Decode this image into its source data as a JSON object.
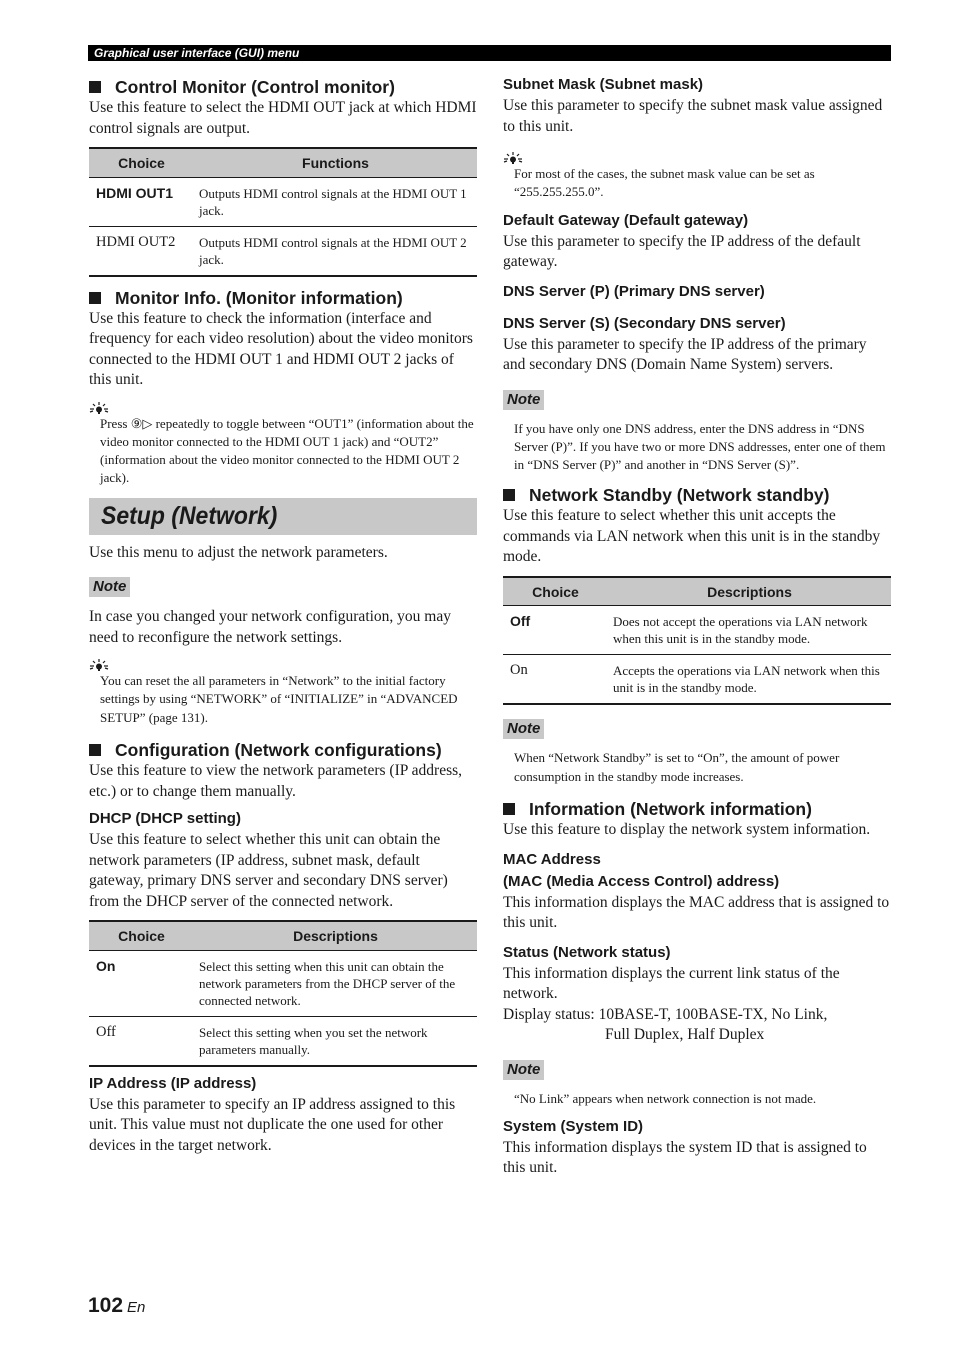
{
  "header": {
    "running_title": "Graphical user interface (GUI) menu"
  },
  "left": {
    "control_monitor": {
      "heading": "Control Monitor (Control monitor)",
      "body": "Use this feature to select the HDMI OUT jack at which HDMI control signals are output.",
      "table": {
        "headers": [
          "Choice",
          "Functions"
        ],
        "rows": [
          {
            "choice": "HDMI OUT1",
            "desc": "Outputs HDMI control signals at the HDMI OUT 1 jack."
          },
          {
            "choice": "HDMI OUT2",
            "desc": "Outputs HDMI control signals at the HDMI OUT 2 jack."
          }
        ]
      }
    },
    "monitor_info": {
      "heading": "Monitor Info. (Monitor information)",
      "body": "Use this feature to check the information (interface and frequency for each video resolution) about the video monitors connected to the HDMI OUT 1 and HDMI OUT 2 jacks of this unit.",
      "tip": "Press ⑨▷ repeatedly to toggle between “OUT1” (information about the video monitor connected to the HDMI OUT 1 jack) and “OUT2” (information about the video monitor connected to the HDMI OUT 2 jack)."
    },
    "setup_network": {
      "title": "Setup (Network)",
      "intro": "Use this menu to adjust the network parameters.",
      "note_label": "Note",
      "note": "In case you changed your network configuration, you may need to reconfigure the network settings.",
      "tip": "You can reset the all parameters in “Network” to the initial factory settings by using “NETWORK” of “INITIALIZE” in “ADVANCED SETUP” (page 131)."
    },
    "configuration": {
      "heading": "Configuration (Network configurations)",
      "body": "Use this feature to view the network parameters (IP address, etc.) or to change them manually.",
      "dhcp_heading": "DHCP (DHCP setting)",
      "dhcp_body": "Use this feature to select whether this unit can obtain the network parameters (IP address, subnet mask, default gateway, primary DNS server and secondary DNS server) from the DHCP server of the connected network.",
      "table": {
        "headers": [
          "Choice",
          "Descriptions"
        ],
        "rows": [
          {
            "choice": "On",
            "desc": "Select this setting when this unit can obtain the network parameters from the DHCP server of the connected network."
          },
          {
            "choice": "Off",
            "desc": "Select this setting when you set the network parameters manually."
          }
        ]
      },
      "ip_heading": "IP Address (IP address)",
      "ip_body": "Use this parameter to specify an IP address assigned to this unit. This value must not duplicate the one used for other devices in the target network."
    }
  },
  "right": {
    "subnet_heading": "Subnet Mask (Subnet mask)",
    "subnet_body": "Use this parameter to specify the subnet mask value assigned to this unit.",
    "subnet_tip": "For most of the cases, the subnet mask value can be set as “255.255.255.0”.",
    "gateway_heading": "Default Gateway (Default gateway)",
    "gateway_body": "Use this parameter to specify the IP address of the default gateway.",
    "dns_p_heading": "DNS Server (P) (Primary DNS server)",
    "dns_s_heading": "DNS Server (S) (Secondary DNS server)",
    "dns_body": "Use this parameter to specify the IP address of the primary and secondary DNS (Domain Name System) servers.",
    "dns_note_label": "Note",
    "dns_note": "If you have only one DNS address, enter the DNS address in “DNS Server (P)”. If you have two or more DNS addresses, enter one of them in “DNS Server (P)” and another in “DNS Server (S)”.",
    "standby": {
      "heading": "Network Standby (Network standby)",
      "body": "Use this feature to select whether this unit accepts the commands via LAN network when this unit is in the standby mode.",
      "table": {
        "headers": [
          "Choice",
          "Descriptions"
        ],
        "rows": [
          {
            "choice": "Off",
            "desc": "Does not accept the operations via LAN network when this unit is in the standby mode."
          },
          {
            "choice": "On",
            "desc": "Accepts the operations via LAN network when this unit is in the standby mode."
          }
        ]
      },
      "note_label": "Note",
      "note": "When “Network Standby” is set to “On”, the amount of power consumption in the standby mode increases."
    },
    "information": {
      "heading": "Information (Network information)",
      "body": "Use this feature to display the network system information.",
      "mac_heading_1": "MAC Address",
      "mac_heading_2": "(MAC (Media Access Control) address)",
      "mac_body": "This information displays the MAC address that is assigned to this unit.",
      "status_heading": "Status (Network status)",
      "status_body": "This information displays the current link status of the network.",
      "display_status_1": "Display status: 10BASE-T, 100BASE-TX, No Link,",
      "display_status_2": "Full Duplex, Half Duplex",
      "note_label": "Note",
      "note": "“No Link” appears when network connection is not made.",
      "system_heading": "System (System ID)",
      "system_body": "This information displays the system ID that is assigned to this unit."
    }
  },
  "footer": {
    "page_number": "102",
    "lang": "En"
  }
}
